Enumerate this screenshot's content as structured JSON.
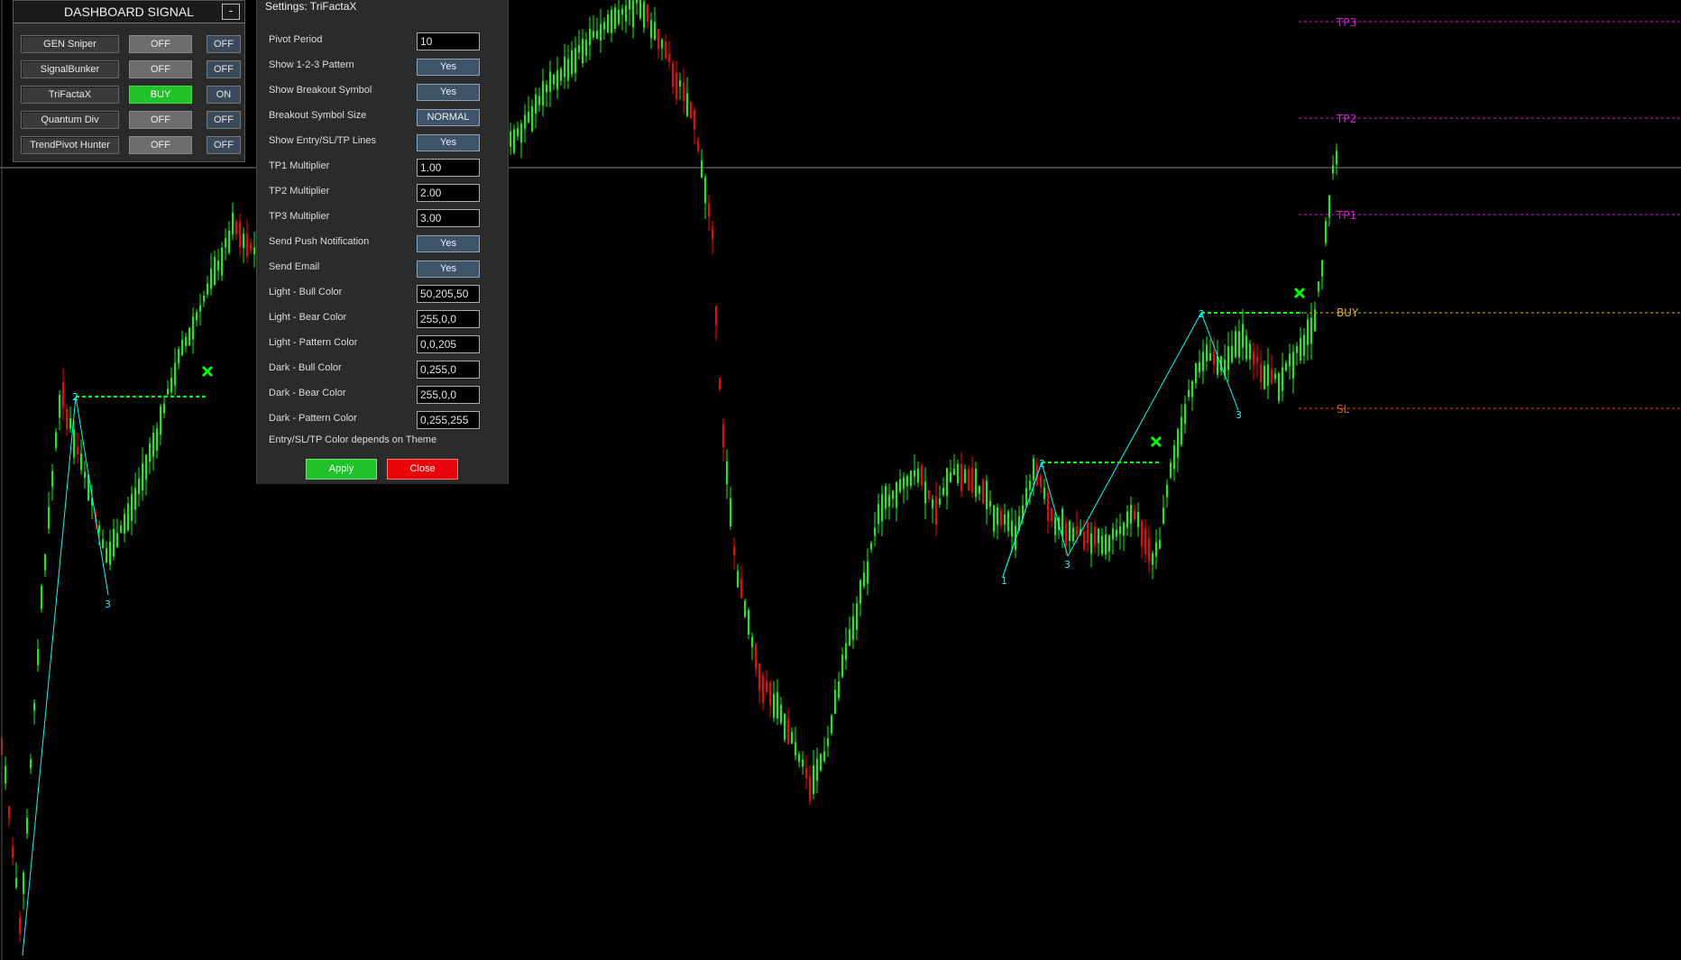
{
  "dashboard": {
    "title": "DASHBOARD SIGNAL",
    "minimize_label": "-",
    "rows": [
      {
        "name": "GEN Sniper",
        "state": "OFF",
        "toggle": "OFF"
      },
      {
        "name": "SignalBunker",
        "state": "OFF",
        "toggle": "OFF"
      },
      {
        "name": "TriFactaX",
        "state": "BUY",
        "toggle": "ON"
      },
      {
        "name": "Quantum Div",
        "state": "OFF",
        "toggle": "OFF"
      },
      {
        "name": "TrendPivot Hunter",
        "state": "OFF",
        "toggle": "OFF"
      }
    ]
  },
  "settings": {
    "title": "Settings: TriFactaX",
    "rows": [
      {
        "label": "Pivot Period",
        "kind": "input",
        "value": "10"
      },
      {
        "label": "Show 1-2-3 Pattern",
        "kind": "button",
        "value": "Yes"
      },
      {
        "label": "Show Breakout Symbol",
        "kind": "button",
        "value": "Yes"
      },
      {
        "label": "Breakout Symbol Size",
        "kind": "button",
        "value": "NORMAL"
      },
      {
        "label": "Show Entry/SL/TP Lines",
        "kind": "button",
        "value": "Yes"
      },
      {
        "label": "TP1 Multiplier",
        "kind": "input",
        "value": "1.00"
      },
      {
        "label": "TP2 Multiplier",
        "kind": "input",
        "value": "2.00"
      },
      {
        "label": "TP3 Multiplier",
        "kind": "input",
        "value": "3.00"
      },
      {
        "label": "Send Push Notification",
        "kind": "button",
        "value": "Yes"
      },
      {
        "label": "Send Email",
        "kind": "button",
        "value": "Yes"
      },
      {
        "label": "Light - Bull Color",
        "kind": "input",
        "value": "50,205,50"
      },
      {
        "label": "Light - Bear Color",
        "kind": "input",
        "value": "255,0,0"
      },
      {
        "label": "Light - Pattern Color",
        "kind": "input",
        "value": "0,0,205"
      },
      {
        "label": "Dark - Bull Color",
        "kind": "input",
        "value": "0,255,0"
      },
      {
        "label": "Dark - Bear Color",
        "kind": "input",
        "value": "255,0,0"
      },
      {
        "label": "Dark - Pattern Color",
        "kind": "input",
        "value": "0,255,255"
      }
    ],
    "note": "Entry/SL/TP Color depends on Theme",
    "apply_label": "Apply",
    "close_label": "Close"
  },
  "chart": {
    "levels": [
      {
        "label": "TP3",
        "color": "#d81ad8"
      },
      {
        "label": "TP2",
        "color": "#d81ad8"
      },
      {
        "label": "TP1",
        "color": "#d81ad8"
      },
      {
        "label": "BUY",
        "color": "#e0b020"
      },
      {
        "label": "SL",
        "color": "#e0501a"
      }
    ],
    "pattern_labels": [
      "2",
      "3",
      "1",
      "2",
      "3",
      "2",
      "3"
    ],
    "colors": {
      "bull": "#00ff00",
      "bear": "#ff0000",
      "pattern": "#00ffff",
      "breakout": "#00ff00",
      "crosshair": "#888888"
    }
  }
}
